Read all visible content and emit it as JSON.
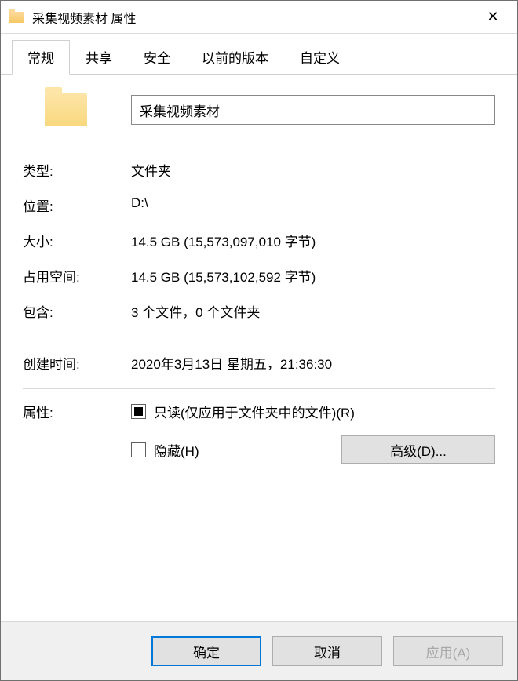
{
  "titlebar": {
    "title": "采集视频素材 属性",
    "close_glyph": "✕"
  },
  "tabs": {
    "general": "常规",
    "sharing": "共享",
    "security": "安全",
    "previous_versions": "以前的版本",
    "customize": "自定义"
  },
  "folder_name": "采集视频素材",
  "props": {
    "type_label": "类型:",
    "type_value": "文件夹",
    "location_label": "位置:",
    "location_value": "D:\\",
    "size_label": "大小:",
    "size_value": "14.5 GB (15,573,097,010 字节)",
    "size_on_disk_label": "占用空间:",
    "size_on_disk_value": "14.5 GB (15,573,102,592 字节)",
    "contains_label": "包含:",
    "contains_value": "3 个文件，0 个文件夹",
    "created_label": "创建时间:",
    "created_value": "2020年3月13日 星期五，21:36:30",
    "attributes_label": "属性:",
    "readonly_label": "只读(仅应用于文件夹中的文件)(R)",
    "hidden_label": "隐藏(H)",
    "advanced_button": "高级(D)..."
  },
  "footer": {
    "ok": "确定",
    "cancel": "取消",
    "apply": "应用(A)"
  }
}
